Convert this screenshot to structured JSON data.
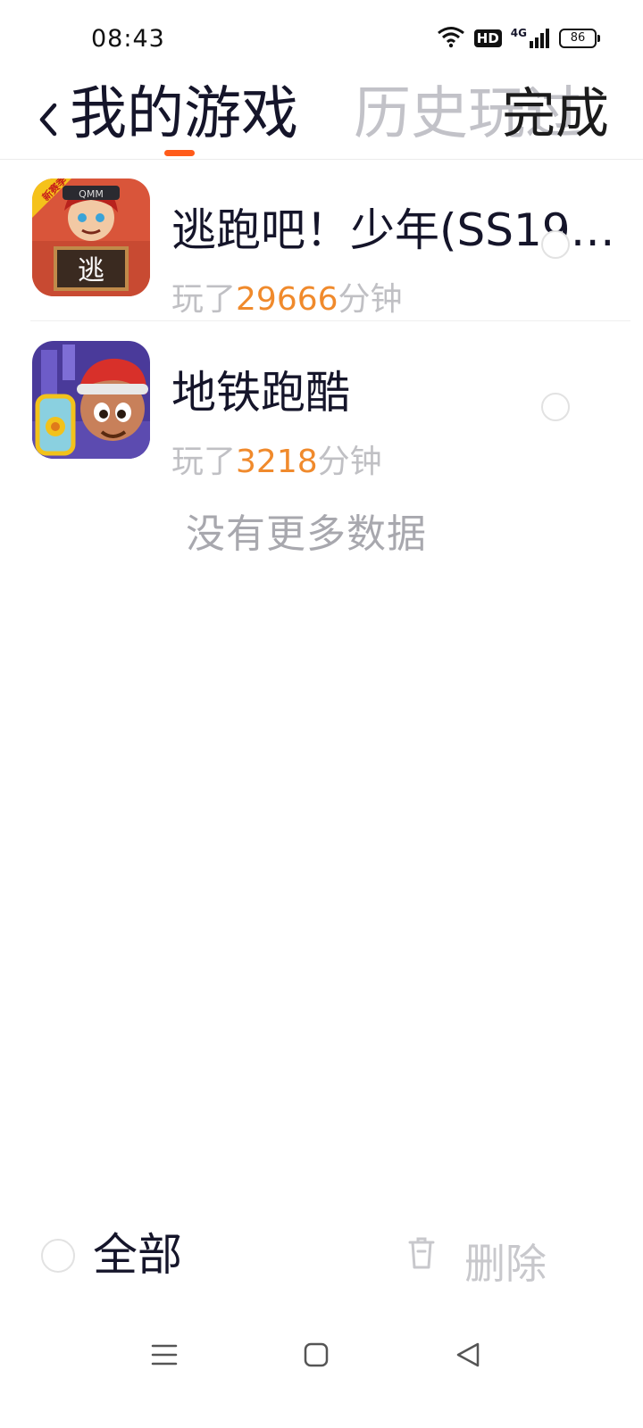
{
  "status": {
    "time": "08:43",
    "hd": "HD",
    "network": "4G",
    "battery": "86"
  },
  "header": {
    "tab_mygames": "我的游戏",
    "tab_history": "历史玩过",
    "done": "完成"
  },
  "games": [
    {
      "name": "逃跑吧！少年(SS19…",
      "played_prefix": "玩了",
      "minutes": "29666",
      "played_suffix": "分钟",
      "icon_badge": "新赛季",
      "icon_tag": "QMM",
      "icon_text": "逃"
    },
    {
      "name": "地铁跑酷",
      "played_prefix": "玩了",
      "minutes": "3218",
      "played_suffix": "分钟"
    }
  ],
  "no_more": "没有更多数据",
  "bottom": {
    "select_all": "全部",
    "delete": "删除"
  },
  "colors": {
    "accent": "#ff5b1a",
    "minutes": "#f08a2c"
  }
}
